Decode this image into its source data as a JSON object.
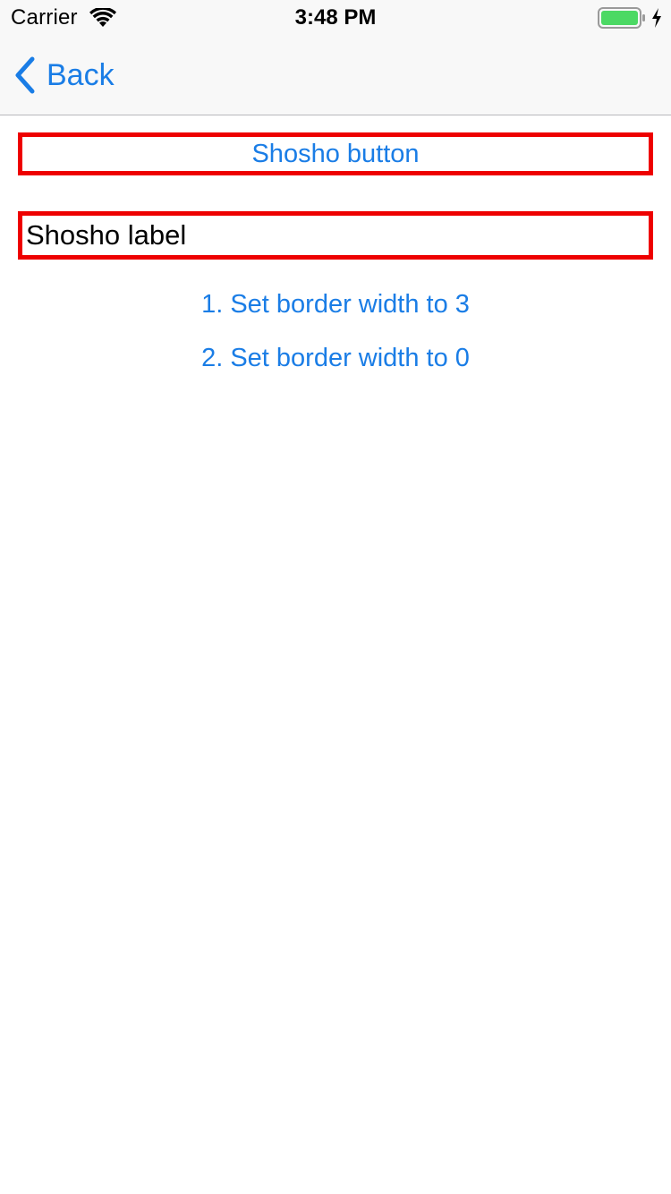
{
  "status_bar": {
    "carrier": "Carrier",
    "time": "3:48 PM",
    "battery_level": 1.0
  },
  "nav_bar": {
    "back_label": "Back"
  },
  "main": {
    "shosho_button_label": "Shosho button",
    "shosho_label_text": "Shosho label",
    "actions": [
      {
        "label": "1. Set border width to 3"
      },
      {
        "label": "2. Set border width to 0"
      }
    ]
  },
  "icons": {
    "wifi": "wifi-icon",
    "battery": "battery-icon",
    "charging": "charging-bolt-icon",
    "back": "chevron-left-icon"
  },
  "colors": {
    "tint": "#1a7de6",
    "border": "#ee0000",
    "battery_fill": "#4cd964",
    "nav_background": "#f8f8f8"
  }
}
